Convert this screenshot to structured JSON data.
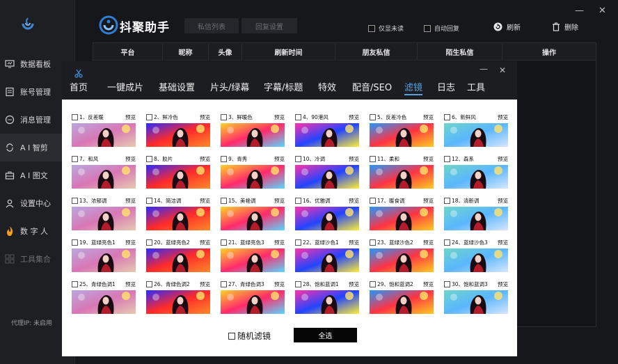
{
  "app": {
    "title": "抖聚助手"
  },
  "sidebar": {
    "items": [
      {
        "label": "数据看板",
        "icon": "monitor-icon"
      },
      {
        "label": "账号管理",
        "icon": "id-card-icon"
      },
      {
        "label": "消息管理",
        "icon": "chat-icon"
      },
      {
        "label": "A I 智剪",
        "icon": "cycle-icon"
      },
      {
        "label": "A I 图文",
        "icon": "briefcase-icon"
      },
      {
        "label": "设置中心",
        "icon": "user-icon"
      },
      {
        "label": "数 字 人",
        "icon": "flame-icon"
      },
      {
        "label": "工具集合",
        "icon": "grid-icon"
      }
    ],
    "proxy_text": "代理IP: 未启用"
  },
  "header": {
    "tabs": [
      "私信列表",
      "回复设置"
    ],
    "checkboxes": [
      "仅显未读",
      "自动回复"
    ],
    "refresh_label": "刷新",
    "delete_label": "删除",
    "minimize": "—",
    "close": "✕"
  },
  "table": {
    "columns": [
      "平台",
      "昵称",
      "头像",
      "刷新时间",
      "朋友私信",
      "陌生私信",
      "操作"
    ]
  },
  "dialog": {
    "minimize": "—",
    "close": "✕",
    "tabs": [
      "首页",
      "一键成片",
      "基础设置",
      "片头/绿幕",
      "字幕/标题",
      "特效",
      "配音/SEO",
      "滤镜",
      "日志",
      "工具"
    ],
    "active_tab": "滤镜",
    "preview_label": "预览",
    "filters": [
      "1、反差暖",
      "2、鲜冷色",
      "3、鲜暖色",
      "4、90港风",
      "5、反差冷色",
      "6、新鲜风",
      "7、和风",
      "8、胶片",
      "9、青秀",
      "10、冷调",
      "11、柔和",
      "12、森系",
      "13、浓郁调",
      "14、简洁调",
      "15、美艳调",
      "16、优雅调",
      "17、暖食调",
      "18、清新调",
      "19、蓝绿亮色1",
      "20、蓝绿亮色2",
      "21、蓝绿亮色3",
      "22、蓝绿沙色1",
      "23、蓝绿沙色2",
      "24、蓝绿沙色3",
      "25、青绿色调1",
      "26、青绿色调2",
      "27、青绿色调3",
      "28、饱和蓝调1",
      "29、饱和蓝调2",
      "30、饱和蓝调3"
    ],
    "random_label": "随机滤镜",
    "select_all_label": "全选"
  },
  "colors": {
    "accent": "#5aa0e6",
    "sidebar_bg": "#1e1f23",
    "dialog_bg": "#1c1d21"
  }
}
